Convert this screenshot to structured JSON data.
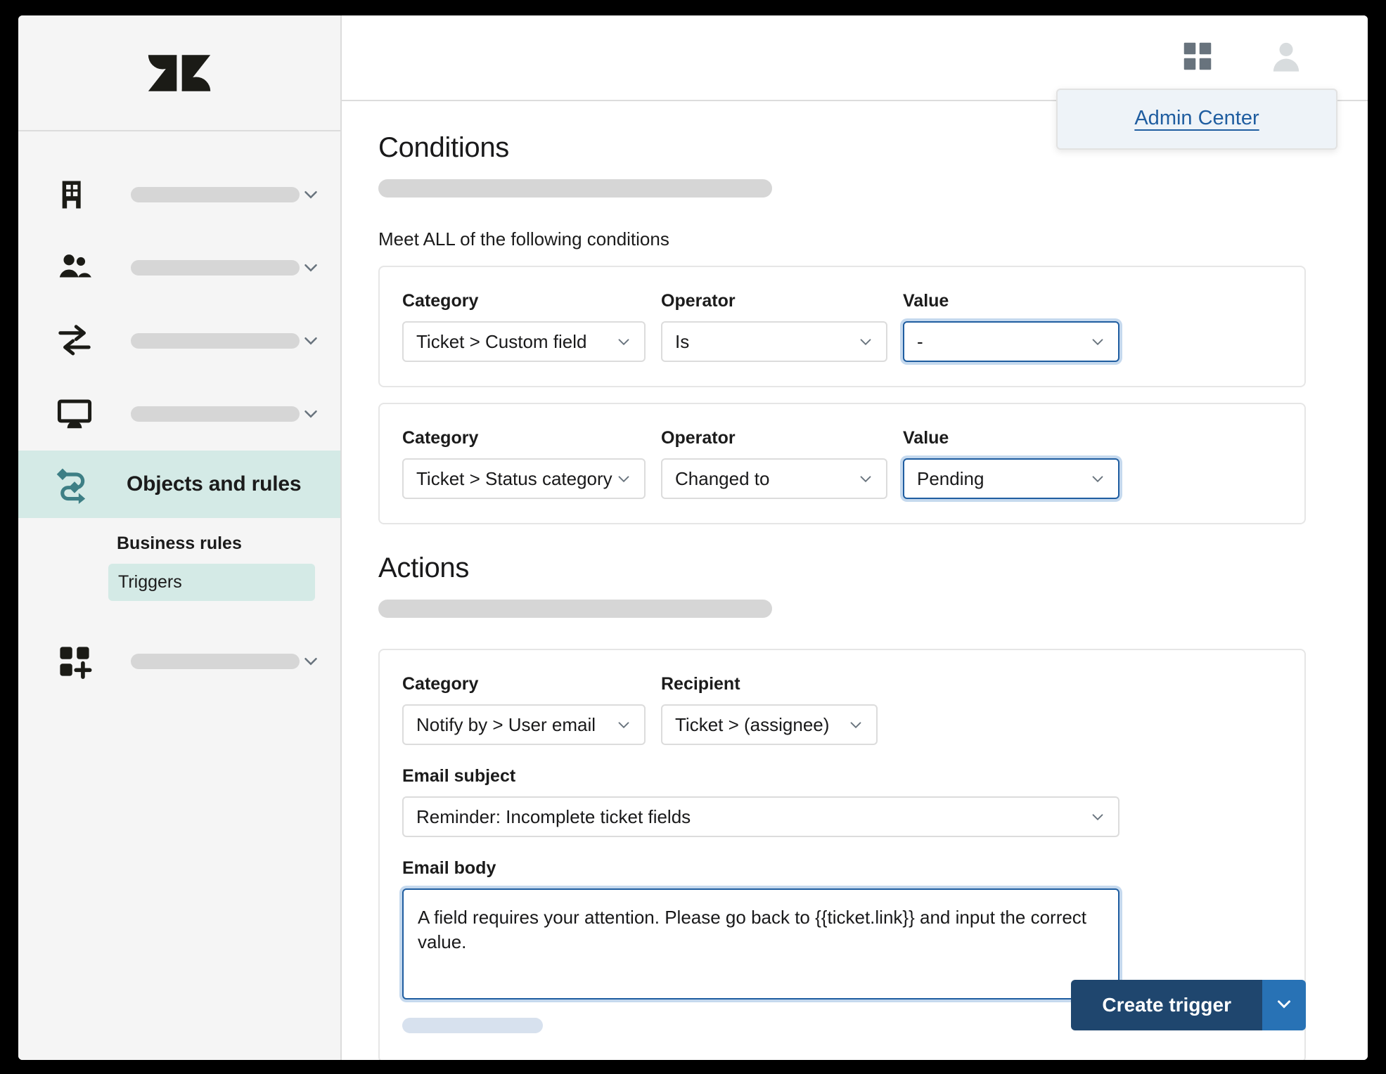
{
  "app": {
    "logo_name": "zendesk-logo"
  },
  "topbar": {
    "products_icon": "grid-apps-icon",
    "avatar_icon": "user-avatar-icon",
    "menu": {
      "admin_center_label": "Admin Center"
    }
  },
  "sidebar": {
    "items": [
      {
        "icon": "building-icon",
        "label": "",
        "has_chevron": true,
        "active": false
      },
      {
        "icon": "people-icon",
        "label": "",
        "has_chevron": true,
        "active": false
      },
      {
        "icon": "transfer-arrows-icon",
        "label": "",
        "has_chevron": true,
        "active": false
      },
      {
        "icon": "monitor-icon",
        "label": "",
        "has_chevron": true,
        "active": false
      },
      {
        "icon": "objects-rules-icon",
        "label": "Objects and rules",
        "has_chevron": false,
        "active": true
      },
      {
        "icon": "apps-add-icon",
        "label": "",
        "has_chevron": true,
        "active": false
      }
    ],
    "sub_heading": "Business rules",
    "sub_items": [
      {
        "label": "Triggers",
        "selected": true
      }
    ]
  },
  "conditions": {
    "title": "Conditions",
    "subtitle_placeholder": "",
    "meet_all_label": "Meet ALL of the following conditions",
    "labels": {
      "category": "Category",
      "operator": "Operator",
      "value": "Value"
    },
    "rows": [
      {
        "category": "Ticket > Custom field",
        "operator": "Is",
        "value": "-",
        "value_focused": true
      },
      {
        "category": "Ticket > Status category",
        "operator": "Changed to",
        "value": "Pending",
        "value_focused": true
      }
    ]
  },
  "actions": {
    "title": "Actions",
    "labels": {
      "category": "Category",
      "recipient": "Recipient",
      "email_subject": "Email subject",
      "email_body": "Email body"
    },
    "category": "Notify by > User email",
    "recipient": "Ticket > (assignee)",
    "email_subject": "Reminder: Incomplete ticket fields",
    "email_body": "A field requires your attention. Please go back to {{ticket.link}} and input the correct value."
  },
  "footer": {
    "create_label": "Create trigger",
    "split_icon": "chevron-down-icon"
  },
  "colors": {
    "accent_teal": "#d4eae6",
    "accent_teal_icon": "#3d7f85",
    "focus_blue": "#1f5da0",
    "focus_ring": "#c5d9ee",
    "primary_btn": "#1f466e",
    "primary_btn_split": "#2872b5",
    "link_blue": "#1f5da0"
  }
}
